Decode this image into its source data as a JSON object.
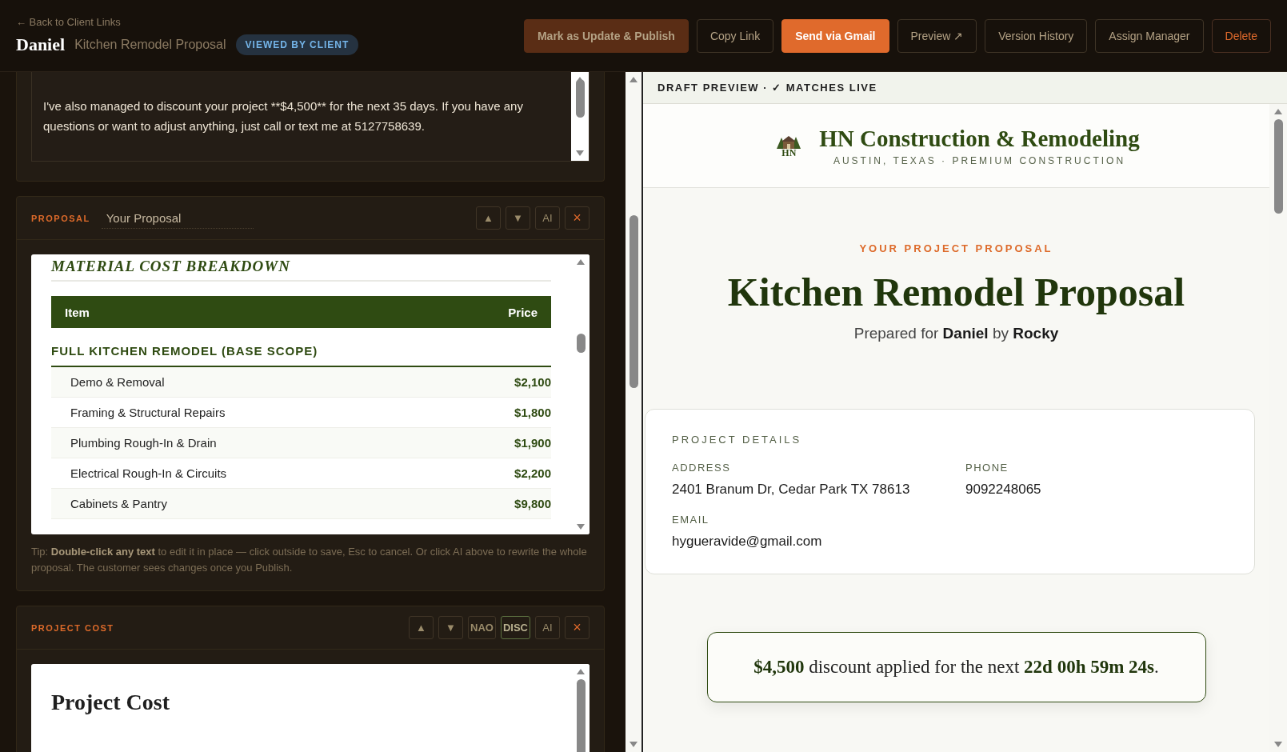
{
  "header": {
    "back_link": "← Back to Client Links",
    "client": "Daniel",
    "title": "Kitchen Remodel Proposal",
    "status": "VIEWED BY CLIENT"
  },
  "actions": [
    {
      "label": "Mark as Update & Publish",
      "kind": "muted"
    },
    {
      "label": "Copy Link",
      "kind": "outline"
    },
    {
      "label": "Send via Gmail",
      "kind": "primary"
    },
    {
      "label": "Preview ↗",
      "kind": "outline"
    },
    {
      "label": "Version History",
      "kind": "outline"
    },
    {
      "label": "Assign Manager",
      "kind": "outline"
    },
    {
      "label": "Delete",
      "kind": "danger"
    }
  ],
  "message": {
    "text": "I've also managed to discount your project **$4,500** for the next 35 days. If you have any questions or want to adjust anything, just call or text me at 5127758639."
  },
  "proposal": {
    "label": "PROPOSAL",
    "title": "Your Proposal",
    "controls": [
      {
        "label": "▲",
        "kind": "move"
      },
      {
        "label": "▼",
        "kind": "move"
      },
      {
        "label": "AI",
        "kind": "ai"
      },
      {
        "label": "×",
        "kind": "remove"
      }
    ],
    "heading": "MATERIAL COST BREAKDOWN",
    "table": {
      "columns": [
        "Item",
        "Price"
      ],
      "group": "FULL KITCHEN REMODEL (BASE SCOPE)",
      "rows": [
        [
          "Demo & Removal",
          "$2,100"
        ],
        [
          "Framing & Structural Repairs",
          "$1,800"
        ],
        [
          "Plumbing Rough-In & Drain",
          "$1,900"
        ],
        [
          "Electrical Rough-In & Circuits",
          "$2,200"
        ],
        [
          "Cabinets & Pantry",
          "$9,800"
        ]
      ]
    },
    "tip": "Tip: **Double-click any text** to edit it in place — click outside to save, Esc to cancel. Or click AI above to rewrite the whole proposal. The customer sees changes once you Publish."
  },
  "project_cost": {
    "label": "PROJECT COST",
    "controls": [
      {
        "label": "▲",
        "kind": "move"
      },
      {
        "label": "▼",
        "kind": "move"
      },
      {
        "label": "NAO",
        "kind": "toggle",
        "on": false
      },
      {
        "label": "DISC",
        "kind": "toggle",
        "on": true
      },
      {
        "label": "AI",
        "kind": "ai"
      },
      {
        "label": "×",
        "kind": "remove"
      }
    ],
    "heading": "Project Cost"
  },
  "preview": {
    "bar": "DRAFT PREVIEW · ✓ MATCHES LIVE",
    "logo_text": "HN",
    "company": "HN Construction & Remodeling",
    "tagline": "AUSTIN, TEXAS · PREMIUM CONSTRUCTION",
    "eyebrow": "YOUR PROJECT PROPOSAL",
    "title": "Kitchen Remodel Proposal",
    "prepared": "Prepared for **Daniel** by **Rocky**",
    "details": {
      "heading": "PROJECT DETAILS",
      "fields": [
        {
          "label": "ADDRESS",
          "value": "2401 Branum Dr, Cedar Park TX 78613"
        },
        {
          "label": "PHONE",
          "value": "9092248065"
        },
        {
          "label": "EMAIL",
          "value": "hygueravide@gmail.com"
        }
      ]
    },
    "banner": "**$4,500** discount applied for the next **22d 00h 59m 24s**."
  }
}
